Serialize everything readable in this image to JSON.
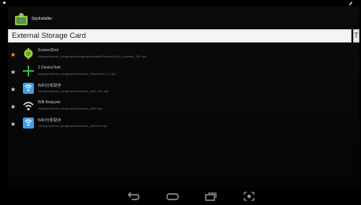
{
  "app": {
    "title": "SpyInstaller",
    "icon": "android-installer-icon"
  },
  "storage": {
    "selected": "External Storage Card",
    "side_glyph": "T"
  },
  "files": [
    {
      "starred": true,
      "name": "ScreenShot",
      "icon": "green-android-icon",
      "path": "/storage/external_storage/sdcard1/appinstall/market/ScreenShot-v1.6_installer_1001.apk"
    },
    {
      "starred": false,
      "name": "1 DeviceTest",
      "icon": "green-cross-icon",
      "path": "/storage/external_storage/sdcard1/device_t/DeviceTest_1.1.apk"
    },
    {
      "starred": false,
      "name": "WiFi分析助手",
      "icon": "blue-app-icon",
      "path": "/storage/external_storage/sdcard1/device_t/wifi_1001.apk"
    },
    {
      "starred": false,
      "name": "Wifi Analyzer",
      "icon": "wifi-icon",
      "path": "/storage/external_storage/sdcard1/device_t/WiFi.apk"
    },
    {
      "starred": false,
      "name": "WiFi分析助手",
      "icon": "blue-app-icon",
      "path": "/storage/external_storage/sdcard1/device_t/wifi1001.apk"
    }
  ],
  "nav": {
    "back": "back-icon",
    "home": "home-icon",
    "recents": "recent-apps-icon",
    "screenshot": "screenshot-icon"
  },
  "colors": {
    "star_on": "#f1a81f",
    "android_green": "#8bc34a",
    "wifi_blue": "#3fa0e6"
  }
}
